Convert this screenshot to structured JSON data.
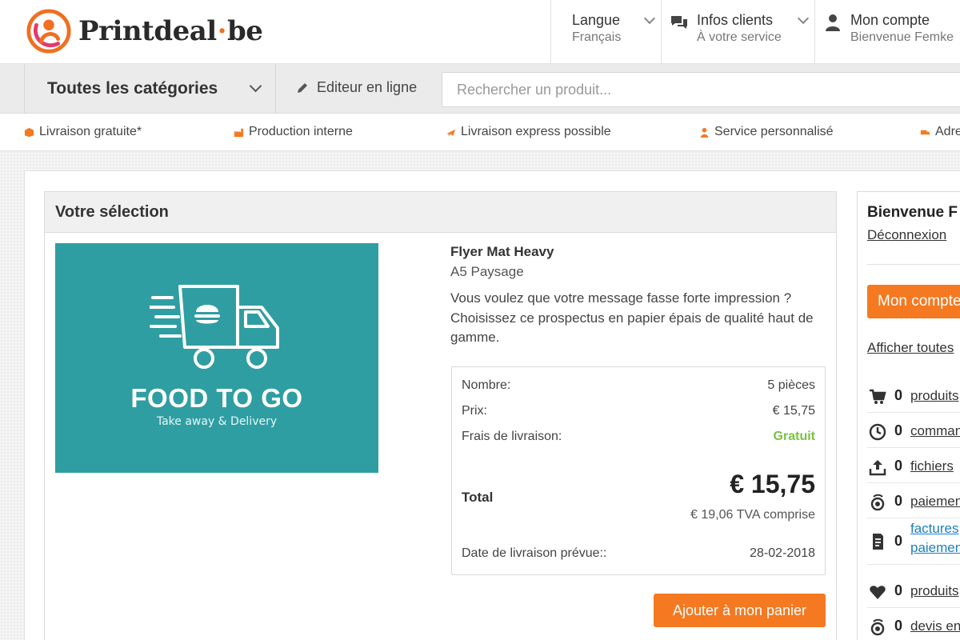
{
  "brand": {
    "name_left": "Printdeal",
    "dot": "·",
    "name_right": "be"
  },
  "header": {
    "language": {
      "title": "Langue",
      "value": "Français"
    },
    "info": {
      "title": "Infos clients",
      "value": "À votre service"
    },
    "account": {
      "title": "Mon compte",
      "value": "Bienvenue Femke"
    }
  },
  "nav": {
    "categories_label": "Toutes les catégories",
    "editor_label": "Editeur en ligne",
    "search_placeholder": "Rechercher un produit..."
  },
  "usps": [
    {
      "label": "Livraison gratuite*",
      "icon": "box-icon"
    },
    {
      "label": "Production interne",
      "icon": "factory-icon"
    },
    {
      "label": "Livraison express possible",
      "icon": "plane-icon"
    },
    {
      "label": "Service personnalisé",
      "icon": "person-icon"
    },
    {
      "label": "Adre",
      "icon": "truck-icon"
    }
  ],
  "selection": {
    "heading": "Votre sélection",
    "image": {
      "title": "FOOD TO GO",
      "subtitle": "Take away & Delivery",
      "bg_color": "#2f9ea2"
    },
    "product_name": "Flyer Mat Heavy",
    "product_format": "A5 Paysage",
    "description": "Vous voulez que votre message fasse forte impression ? Choisissez ce prospectus en papier épais de qualité haut de gamme.",
    "price": {
      "quantity_label": "Nombre:",
      "quantity_value": "5 pièces",
      "price_label": "Prix:",
      "price_value": "€ 15,75",
      "shipping_label": "Frais de livraison:",
      "shipping_value": "Gratuit",
      "total_label": "Total",
      "total_value": "€ 15,75",
      "vat_note": "€ 19,06 TVA comprise",
      "delivery_label": "Date de livraison prévue::",
      "delivery_value": "28-02-2018"
    },
    "add_to_cart_label": "Ajouter à mon panier"
  },
  "account_panel": {
    "title": "Bienvenue F",
    "logout_label": "Déconnexion",
    "button_label": "Mon compte",
    "show_all_label": "Afficher toutes",
    "rows": [
      {
        "icon": "cart-icon",
        "count": "0",
        "label": "produits"
      },
      {
        "icon": "clock-icon",
        "count": "0",
        "label": "commandes"
      },
      {
        "icon": "upload-icon",
        "count": "0",
        "label": "fichiers"
      },
      {
        "icon": "payment-icon",
        "count": "0",
        "label": "paiements"
      },
      {
        "icon": "invoice-icon",
        "count": "0",
        "label": "factures",
        "label2": "paiements"
      },
      {
        "icon": "heart-icon",
        "count": "0",
        "label": "produits"
      },
      {
        "icon": "quote-icon",
        "count": "0",
        "label": "devis en"
      }
    ]
  },
  "colors": {
    "accent": "#f47920",
    "free": "#7ac142",
    "link_blue": "#1a7fc1"
  }
}
